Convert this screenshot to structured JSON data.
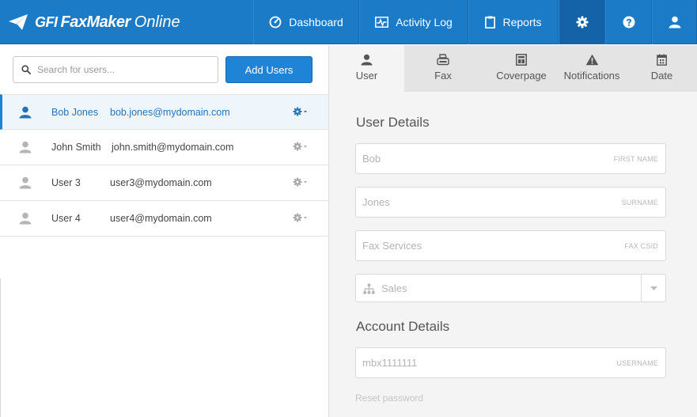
{
  "brand": {
    "gfi": "GFI",
    "product": "FaxMaker",
    "suffix": "Online"
  },
  "nav": {
    "dashboard": "Dashboard",
    "activity_log": "Activity Log",
    "reports": "Reports",
    "settings_icon": "gear-icon",
    "help_icon": "question-icon",
    "user_icon": "user-icon"
  },
  "search": {
    "placeholder": "Search for users..."
  },
  "add_users_label": "Add Users",
  "users": [
    {
      "name": "Bob Jones",
      "email": "bob.jones@mydomain.com",
      "selected": true
    },
    {
      "name": "John Smith",
      "email": "john.smith@mydomain.com",
      "selected": false
    },
    {
      "name": "User 3",
      "email": "user3@mydomain.com",
      "selected": false
    },
    {
      "name": "User 4",
      "email": "user4@mydomain.com",
      "selected": false
    }
  ],
  "tabs": {
    "user": "User",
    "fax": "Fax",
    "coverpage": "Coverpage",
    "notifications": "Notifications",
    "date": "Date",
    "active": "User"
  },
  "user_details": {
    "title": "User Details",
    "first_name": {
      "value": "Bob",
      "label": "FIRST NAME"
    },
    "surname": {
      "value": "Jones",
      "label": "SURNAME"
    },
    "fax_csid": {
      "value": "Fax Services",
      "label": "FAX CSID"
    },
    "department": {
      "value": "Sales"
    }
  },
  "account_details": {
    "title": "Account Details",
    "username": {
      "value": "mbx1111111",
      "label": "USERNAME"
    },
    "reset_password": "Reset password"
  },
  "colors": {
    "primary": "#1b7bc6",
    "active_nav": "#1463a8",
    "accent": "#1f83d6"
  }
}
